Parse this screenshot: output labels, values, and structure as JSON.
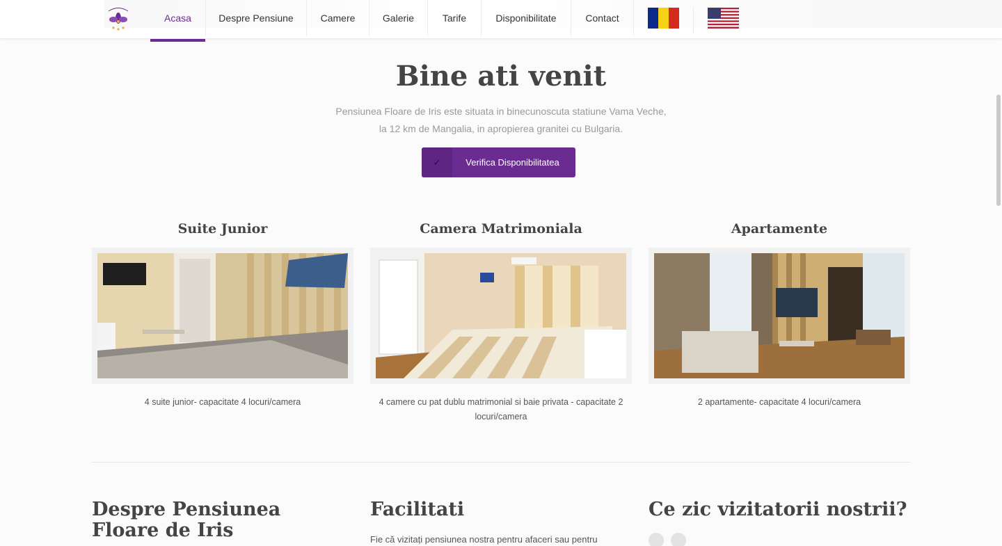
{
  "header": {
    "logo_alt": "Floare de Iris",
    "nav": [
      {
        "label": "Acasa",
        "active": true
      },
      {
        "label": "Despre Pensiune",
        "active": false
      },
      {
        "label": "Camere",
        "active": false
      },
      {
        "label": "Galerie",
        "active": false
      },
      {
        "label": "Tarife",
        "active": false
      },
      {
        "label": "Disponibilitate",
        "active": false
      },
      {
        "label": "Contact",
        "active": false
      }
    ],
    "languages": [
      "romanian-flag-icon",
      "us-flag-icon"
    ]
  },
  "hero": {
    "title": "Bine ati venit",
    "text_line1": "Pensiunea Floare de Iris este situata in binecunoscuta statiune Vama Veche,",
    "text_line2": "la 12 km de Mangalia, in apropierea granitei cu Bulgaria.",
    "cta_icon": "check-icon",
    "cta_label": "Verifica Disponibilitatea"
  },
  "rooms": [
    {
      "title": "Suite Junior",
      "description": "4 suite junior- capacitate 4 locuri/camera"
    },
    {
      "title": "Camera Matrimoniala",
      "description": "4 camere cu pat dublu matrimonial si baie privata - capacitate 2 locuri/camera"
    },
    {
      "title": "Apartamente",
      "description": "2 apartamente- capacitate 4 locuri/camera"
    }
  ],
  "sections": {
    "about_title": "Despre Pensiunea Floare de Iris",
    "facilities_title": "Facilitati",
    "facilities_text": "Fie că vizitați pensiunea nostra pentru afaceri sau pentru",
    "reviews_title": "Ce zic vizitatorii nostrii?"
  },
  "colors": {
    "accent": "#6a2c91",
    "text": "#444444",
    "muted": "#9a9a9a"
  }
}
